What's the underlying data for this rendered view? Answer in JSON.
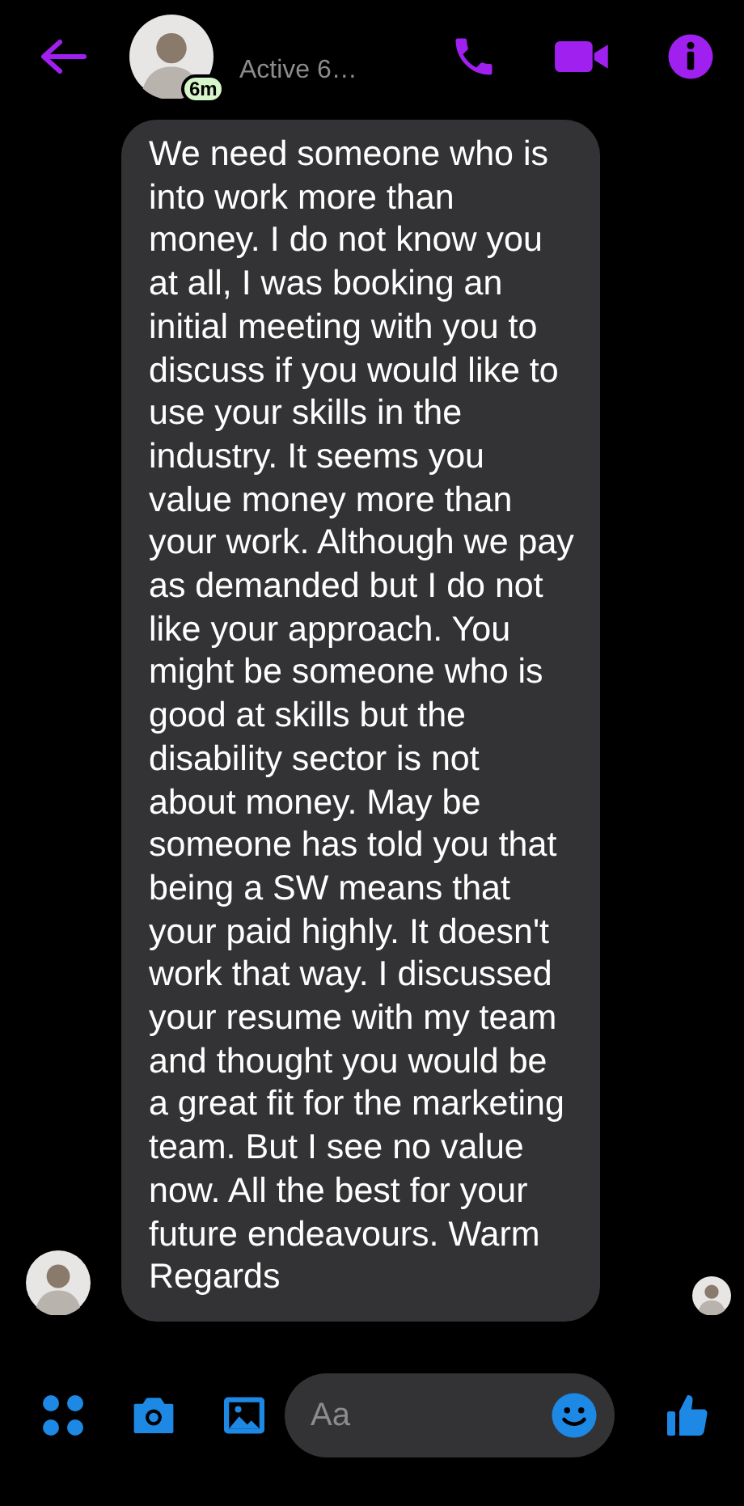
{
  "header": {
    "active_badge": "6m",
    "status": "Active 6…"
  },
  "message": {
    "text": "We need someone who is into work more than money. I do not know you at all, I was booking an initial meeting with you to discuss if you would like to use your skills in the industry. It seems you value money more than your work. Although we pay as demanded but I do not like your approach. You might be someone who is good at skills but the disability sector is not about money. May be someone has told you that being a SW means that your paid highly. It doesn't work that way. I discussed your resume with my team and thought you would be a great fit for the marketing team. But I see no value now. All the best for your future endeavours. Warm Regards",
    "seen": true
  },
  "composer": {
    "placeholder": "Aa"
  }
}
